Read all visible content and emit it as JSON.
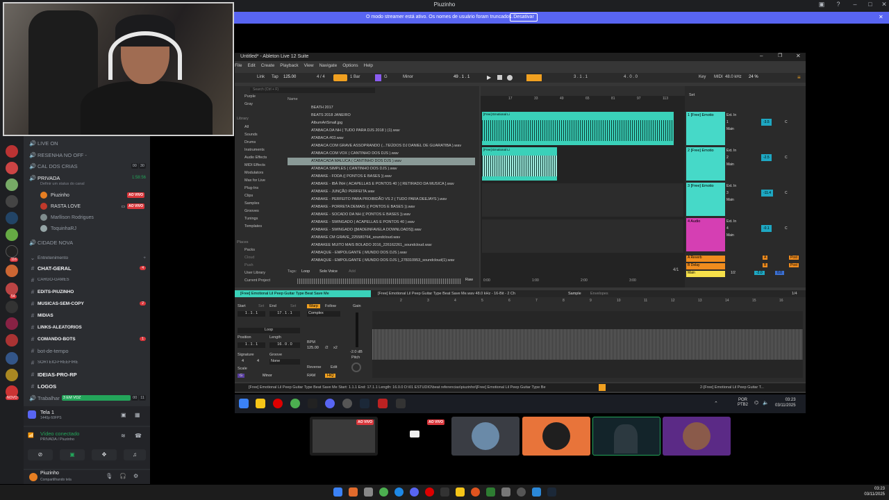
{
  "discord": {
    "window_title": "Piuzinho",
    "streamer_banner": {
      "text": "O modo streamer está ativo. Os nomes de usuário foram truncados.",
      "button": "Desativar"
    },
    "channels": [
      {
        "label": "LIVE ON",
        "type": "voice"
      },
      {
        "label": "RESENHA NO OFF -",
        "type": "voice"
      },
      {
        "label": "CAL DOS CRIAS",
        "type": "voice",
        "pills": [
          "00",
          "30"
        ]
      },
      {
        "label": "PRIVADA",
        "type": "voice-active",
        "time": "1:58:56",
        "status": "Definir um status do canal"
      }
    ],
    "voice_users": [
      {
        "name": "Piuzinho",
        "badge": "AO VIVO",
        "color": "#e67e22"
      },
      {
        "name": "RASTA LOVE",
        "badge": "AO VIVO",
        "color": "#c0392b"
      },
      {
        "name": "Marllison Rodrigues",
        "badge": "",
        "color": "#7f8c8d"
      },
      {
        "name": "ToquinhaRJ",
        "badge": "",
        "color": "#95a5a6"
      }
    ],
    "channels_after": [
      {
        "label": "CIDADE NOVA",
        "type": "voice"
      },
      {
        "label": "Entretenimento",
        "type": "category"
      },
      {
        "label": "CHAT-GERAL",
        "type": "text",
        "bold": true,
        "badge": "4"
      },
      {
        "label": "CARGO-GAMES",
        "type": "text"
      },
      {
        "label": "EDITS-PIUZINHO",
        "type": "text",
        "bold": true
      },
      {
        "label": "MUSICAS-SEM-COPY",
        "type": "text",
        "bold": true,
        "badge": "2"
      },
      {
        "label": "MIDIAS",
        "type": "text",
        "bold": true
      },
      {
        "label": "LINKS-ALEATORIOS",
        "type": "text",
        "bold": true
      },
      {
        "label": "COMANDO-BOTS",
        "type": "text",
        "bold": true,
        "badge": "1"
      },
      {
        "label": "bot-de-tempo",
        "type": "text"
      },
      {
        "label": "SORTEIO-FREEFIRE",
        "type": "text"
      },
      {
        "label": "IDEIAS-PRO-RP",
        "type": "text",
        "bold": true
      },
      {
        "label": "LOGOS",
        "type": "text",
        "bold": true
      },
      {
        "label": "Trabalhar",
        "type": "voice",
        "extra": "3 EM VOZ",
        "pills": [
          "00",
          "11"
        ]
      }
    ],
    "server_badges": [
      "116",
      "54",
      "NOVO"
    ],
    "screen_share": {
      "title": "Tela 1",
      "sub": "1440p 60FPS"
    },
    "voice_connected": {
      "title": "Vídeo conectado",
      "sub": "PRIVADA / Piuzinho"
    },
    "user_panel": {
      "name": "Piuzinho",
      "status": "Compartilhando tela"
    },
    "tile_badges": [
      "AO VIVO",
      "AO VIVO"
    ]
  },
  "ableton": {
    "title": "Untitled* - Ableton Live 12 Suite",
    "menu": [
      "File",
      "Edit",
      "Create",
      "Playback",
      "View",
      "Navigate",
      "Options",
      "Help"
    ],
    "transport": {
      "link": "Link",
      "tap": "Tap",
      "tempo": "125.00",
      "signature": "4 / 4",
      "quantize": "1 Bar",
      "key": "G",
      "scale": "Minor",
      "position": "49 . 1 . 1",
      "loop_start": "3 . 1 . 1",
      "loop_len": "4 . 0 . 0",
      "key_label": "Key",
      "midi_label": "MIDI",
      "sample_rate": "48.0 kHz",
      "cpu": "24 %"
    },
    "browser": {
      "search_placeholder": "Search (Ctrl + F)",
      "colors": [
        "Purple",
        "Gray"
      ],
      "library_head": "Library",
      "categories": [
        "All",
        "Sounds",
        "Drums",
        "Instruments",
        "Audio Effects",
        "MIDI Effects",
        "Modulators",
        "Max for Live",
        "Plug-Ins",
        "Clips",
        "Samples",
        "Grooves",
        "Tunings",
        "Templates"
      ],
      "places_head": "Places",
      "places": [
        "Packs",
        "Cloud",
        "Push",
        "User Library",
        "Current Project"
      ],
      "name_header": "Name",
      "files": [
        "BEATH 2017",
        "BEATS 2018 JANEIRO",
        "AlbumArtSmall.jpg",
        "ATABACA DA NH ( TUDO PARA DJS 2018 ) (1).wav",
        "ATABACA #03.wav",
        "ATABACA COM GRAVE ASSOPRANDO (...TEÚDOS DJ DANIEL DE GUARATIBA ).wav",
        "ATABACA COM VOX ( CANTINHO DOS DJS ).wav",
        "ATABACADA MALUCA ( CANTINHO DOS DJS ).wav",
        "ATABACA SIMPLES ( CANTINHO DOS DJS ).wav",
        "ATABAKE - FODA (( PONTOS E BASES )).wav",
        "ATABAKE - IBÁ ÍNH ( ACAPELLAS E PONTOS 40 ) [ RETIRADO DA MUSICA ].wav",
        "ATABAKE - JUNÇÃO PERFEITA.wav",
        "ATABAKE - PERFEITO PARA PROIBIDÃO VS 2 ( TUDO PARA DEEJAYS ).wav",
        "ATABAKE - PORRETA DEMAIS (( PONTOS E BASES )).wav",
        "ATABAKE - SOCADO DA NH (( PONTOS E BASES )).wav",
        "ATABAKE - SWINGADO ( ACAPELLAS E PONTOS 40 ).wav",
        "ATABAKE - SWINGADO ([MADEINFAVELA DOWNLOADS]).wav",
        "ATABAKE CM GRAVE_225580764_soundcloud.wav",
        "ATABAKEE MUITO MAIS BOLADO 2016_226162261_soundcloud.wav",
        "ATABAQUE - EMPOLGANTE ( MUNDO DOS DJS ).wav",
        "ATABAQUE - EMPOLGANTE ( MUNDO DOS DJS )_278310953_soundcloud(1).wav"
      ],
      "selected_index": 7,
      "tags_label": "Tags:",
      "tags": [
        "Loop",
        "Solo Voice",
        "Add"
      ],
      "raw": "Raw"
    },
    "arrangement": {
      "ruler": [
        "17",
        "33",
        "49",
        "65",
        "81",
        "97",
        "113"
      ],
      "time_ruler": [
        "0:00",
        "1:00",
        "2:00",
        "3:00"
      ],
      "clip_label": "[Free] Emotional Li",
      "page": "4/1"
    },
    "tracks": [
      {
        "name": "1 [Free] Emotio",
        "color": "#46d9c8",
        "input": "Ext. In",
        "num": "1",
        "route": "Main",
        "vol": "-3.5",
        "pan": "C"
      },
      {
        "name": "2 [Free] Emotio",
        "color": "#46d9c8",
        "input": "Ext. In",
        "num": "2",
        "route": "Main",
        "vol": "-2.5",
        "pan": "C"
      },
      {
        "name": "3 [Free] Emotio",
        "color": "#46d9c8",
        "input": "Ext. In",
        "num": "3",
        "route": "Main",
        "vol": "-11.4",
        "pan": "C"
      },
      {
        "name": "4 Audio",
        "color": "#d53fb3",
        "input": "Ext. In",
        "num": "4",
        "route": "Main",
        "vol": "-0.1",
        "pan": "C"
      }
    ],
    "returns": [
      {
        "name": "A Reverb",
        "letter": "A",
        "post": "Post"
      },
      {
        "name": "B Delay",
        "letter": "B",
        "post": "Post"
      }
    ],
    "main": {
      "name": "Main",
      "route": "1/2",
      "vol": "-2.0",
      "pan": "0.0",
      "set": "Set"
    },
    "detail": {
      "clip_name": "[Free] Emotional Lil Peep Guitar Type Beat Save Me",
      "file_info": "[Free] Emotional Lil Peep Guitar Type Beat Save Me.wav  48.0 kHz - 16-Bit - 2 Ch",
      "tabs": [
        "Sample",
        "Envelopes"
      ],
      "page": "1/4",
      "start_label": "Start",
      "end_label": "End",
      "set_label": "Set",
      "start": "1 . 1 . 1",
      "end": "17 . 1 . 1",
      "warp": "Warp",
      "follow": "Follow",
      "mode": "Complex",
      "loop": "Loop",
      "position_label": "Position",
      "length_label": "Length",
      "position": "1 . 1 . 1",
      "length": "16 . 0 . 0",
      "bpm_label": "BPM",
      "bpm": "125.00",
      "half": "/2",
      "double": "x2",
      "signature_label": "Signature",
      "groove_label": "Groove",
      "sig_num": "4",
      "sig_den": "4",
      "groove": "None",
      "scale_label": "Scale",
      "scale_key": "G",
      "scale_mode": "Minor",
      "reverse": "Reverse",
      "edit": "Edit",
      "ram": "RAM",
      "hiq": "HiQ",
      "gain_label": "Gain",
      "gain": "-2.0 dB",
      "pitch_label": "Pitch",
      "detail_ruler": [
        "2",
        "3",
        "4",
        "5",
        "6",
        "7",
        "8",
        "9",
        "10",
        "11",
        "12",
        "13",
        "14",
        "15",
        "16"
      ]
    },
    "status": "[Free] Emotional Lil Peep Guitar Type Beat Save Me  Start: 1.1.1  End: 17.1.1  Length: 16.0.0  D:\\01 ESTUDIO\\beat referencias\\piuzinho\\[Free] Emotional Lil Peep Guitar Type Be",
    "status_right": "2-[Free] Emotional Lil Peep Guitar T..."
  },
  "inner_taskbar": {
    "lang": "POR",
    "layout": "PTB2",
    "time": "03:23",
    "date": "03/11/2025"
  },
  "os_taskbar": {
    "time": "03:23",
    "date": "03/11/2025"
  }
}
